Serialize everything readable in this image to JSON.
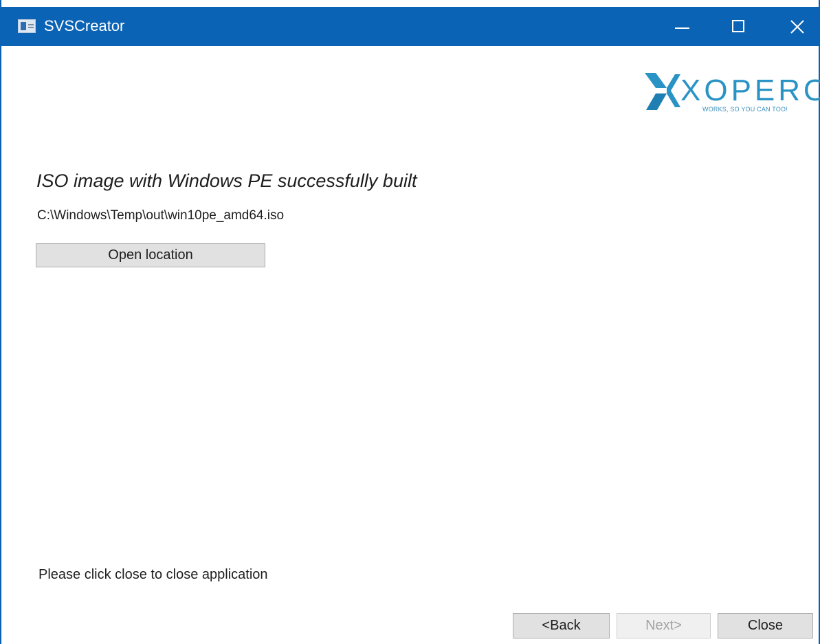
{
  "window": {
    "title": "SVSCreator"
  },
  "logo": {
    "wordmark": "XOPERO",
    "tagline": "WORKS, SO YOU CAN TOO!",
    "brand_color": "#2a93c5"
  },
  "content": {
    "heading": "ISO image with Windows PE successfully built",
    "iso_path": "C:\\Windows\\Temp\\out\\win10pe_amd64.iso",
    "open_location_label": "Open location",
    "status_message": "Please click close to close application"
  },
  "footer": {
    "back_label": "<Back",
    "next_label": "Next>",
    "close_label": "Close"
  },
  "colors": {
    "titlebar": "#0b63b5",
    "button_face": "#e1e1e1",
    "disabled_text": "#a3a3a3"
  }
}
